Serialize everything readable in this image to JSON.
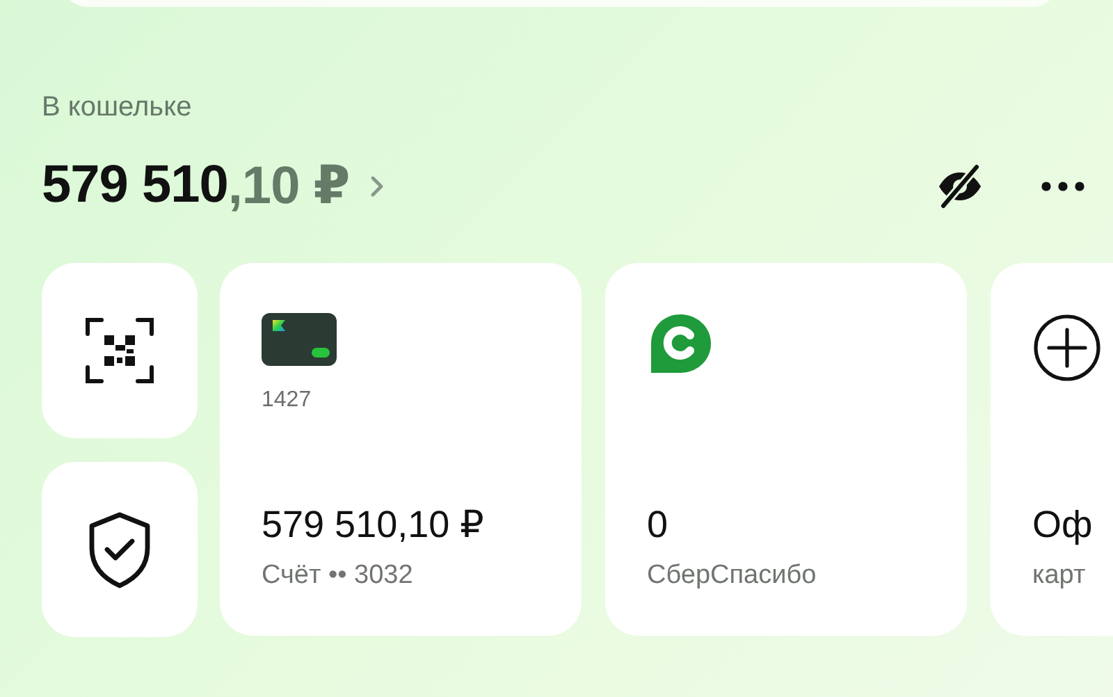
{
  "wallet": {
    "label": "В кошельке",
    "balance_whole": "579 510",
    "balance_fraction": ",10 ₽"
  },
  "quick_actions": [
    {
      "kind": "qr"
    },
    {
      "kind": "shield"
    }
  ],
  "cards": [
    {
      "kind": "bank_card",
      "card_number": "1427",
      "amount": "579 510,10 ₽",
      "caption": "Счёт •• 3032"
    },
    {
      "kind": "bonus",
      "amount": "0",
      "caption": "СберСпасибо"
    },
    {
      "kind": "add",
      "amount": "Оф",
      "caption": "карт"
    }
  ]
}
